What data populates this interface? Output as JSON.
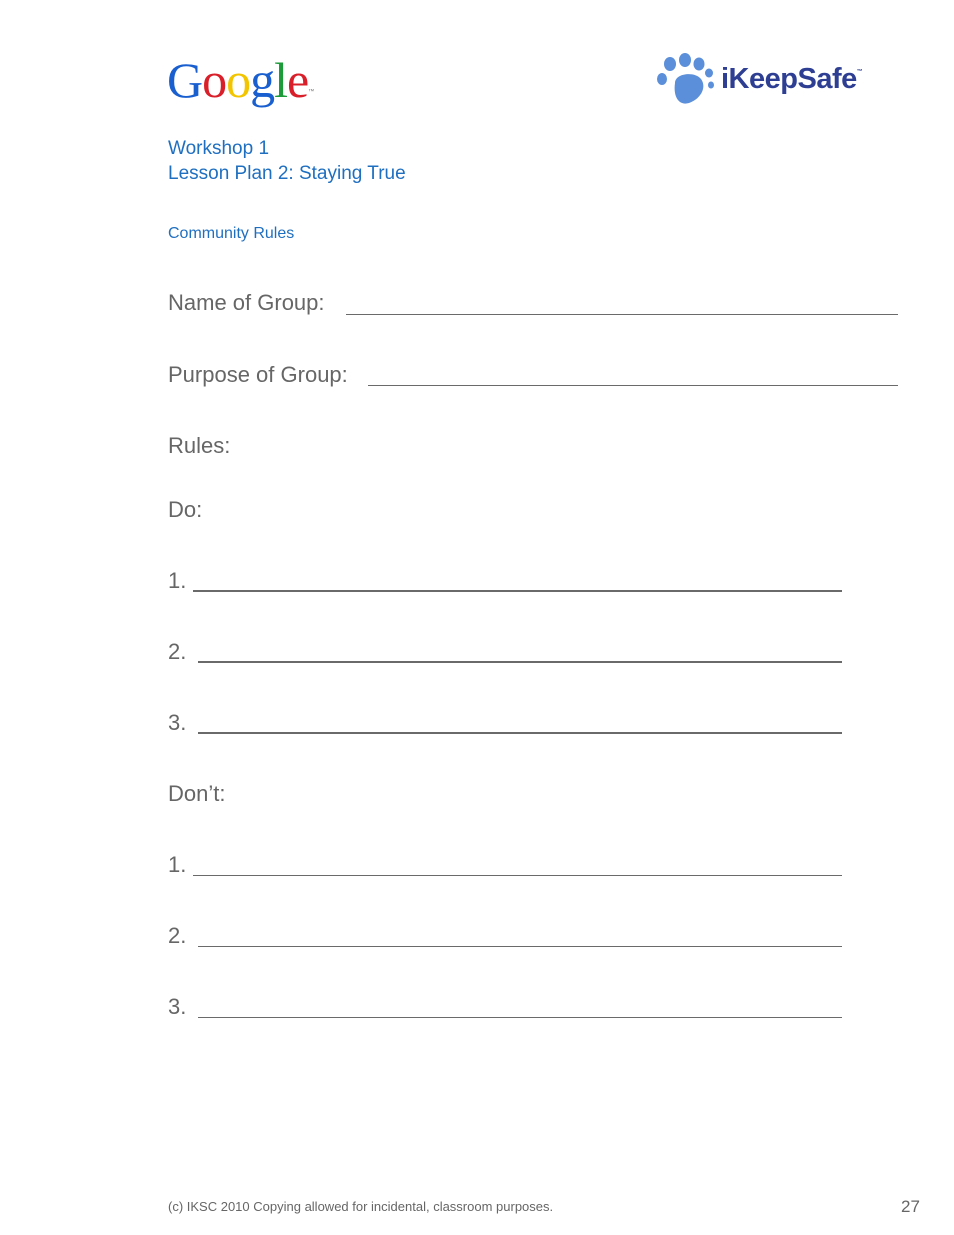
{
  "logos": {
    "google": {
      "letters": [
        {
          "char": "G",
          "color": "#1a5fd0"
        },
        {
          "char": "o",
          "color": "#d9202a"
        },
        {
          "char": "o",
          "color": "#f2c500"
        },
        {
          "char": "g",
          "color": "#1a5fd0"
        },
        {
          "char": "l",
          "color": "#1d9a3a"
        },
        {
          "char": "e",
          "color": "#d9202a"
        }
      ],
      "trademark": "™"
    },
    "ikeepsafe": {
      "text": "iKeepSafe",
      "trademark": "™",
      "paw_color": "#5b8fd9",
      "text_color": "#2e3f93"
    }
  },
  "header": {
    "workshop": "Workshop 1",
    "lesson": "Lesson Plan 2: Staying True",
    "section": "Community Rules"
  },
  "form": {
    "name_label": "Name of Group:",
    "purpose_label": "Purpose of Group:",
    "rules_label": "Rules:",
    "do_label": "Do:",
    "do_items": [
      "1.",
      "2.",
      "3."
    ],
    "dont_label": "Don’t:",
    "dont_items": [
      "1.",
      "2.",
      "3."
    ]
  },
  "footer": {
    "copyright": "(c) IKSC 2010 Copying allowed for incidental, classroom purposes.",
    "page_number": "27"
  }
}
